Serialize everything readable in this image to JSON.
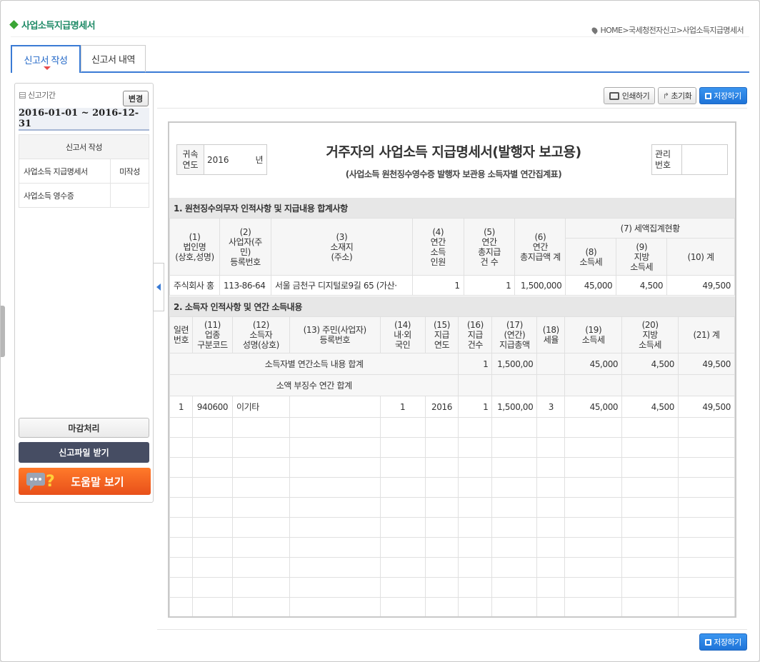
{
  "page": {
    "title": "사업소득지급명세서",
    "breadcrumb": [
      "HOME",
      ">",
      "국세청전자신고",
      ">",
      "사업소득지급명세서"
    ]
  },
  "tabs": [
    {
      "label": "신고서 작성",
      "active": true
    },
    {
      "label": "신고서 내역",
      "active": false
    }
  ],
  "sidebar": {
    "period_label": "신고기간",
    "change_button": "변경",
    "period_value": "2016-01-01 ~ 2016-12-31",
    "list_header": "신고서 작성",
    "items": [
      {
        "name": "사업소득 지급명세서",
        "status": "미작성"
      },
      {
        "name": "사업소득 영수증",
        "status": ""
      }
    ],
    "close_button": "마감처리",
    "file_button": "신고파일 받기",
    "help_button": "도움말 보기"
  },
  "toolbar": {
    "print": "인쇄하기",
    "reset": "초기화",
    "save": "저장하기"
  },
  "bottom": {
    "save": "저장하기"
  },
  "document": {
    "year_label": "귀속\n연도",
    "year_value": "2016",
    "year_unit": "년",
    "title": "거주자의 사업소득 지급명세서(발행자 보고용)",
    "subtitle": "(사업소득 원천징수영수증 발행자 보관용 소득자별 연간집계표)",
    "mgmt_label": "관리\n번호",
    "mgmt_value": "",
    "section1": {
      "title": "1. 원천징수의무자 인적사항 및 지급내용 합계사항",
      "headers": {
        "h1": "(1)\n법인명\n(상호,성명)",
        "h2": "(2)\n사업자(주\n민)\n등록번호",
        "h3": "(3)\n소재지\n(주소)",
        "h4": "(4)\n연간\n소득\n인원",
        "h5": "(5)\n연간\n총지급\n건 수",
        "h6": "(6)\n연간\n총지급액 계",
        "h7": "(7) 세액집계현황",
        "h8": "(8)\n소득세",
        "h9": "(9)\n지방\n소득세",
        "h10": "(10) 계"
      },
      "row": {
        "name": "주식회사 홍",
        "regno": "113-86-64",
        "addr": "서울 금천구 디지털로9길 65 (가산·",
        "count": "1",
        "cases": "1",
        "total": "1,500,000",
        "tax": "45,000",
        "local": "4,500",
        "sum": "49,500"
      }
    },
    "section2": {
      "title": "2. 소득자 인적사항 및 연간 소득내용",
      "headers": {
        "seq": "일련\n번호",
        "h11": "(11)\n업종\n구분코드",
        "h12": "(12)\n소득자\n성명(상호)",
        "h13": "(13) 주민(사업자)\n등록번호",
        "h14": "(14)\n내·외\n국인",
        "h15": "(15)\n지급\n연도",
        "h16": "(16)\n지급\n건수",
        "h17": "(17)\n(연간)\n지급총액",
        "h18": "(18)\n세율",
        "h19": "(19)\n소득세",
        "h20": "(20)\n지방\n소득세",
        "h21": "(21) 계"
      },
      "sum_row": {
        "label": "소득자별 연간소득 내용 합계",
        "cases": "1",
        "total": "1,500,00",
        "tax": "45,000",
        "local": "4,500",
        "sum": "49,500"
      },
      "small_row": {
        "label": "소액 부징수 연간 합계"
      },
      "rows": [
        {
          "seq": "1",
          "code": "940600",
          "name": "이기타",
          "regno": "",
          "foreign": "1",
          "year": "2016",
          "cases": "1",
          "total": "1,500,00",
          "rate": "3",
          "tax": "45,000",
          "local": "4,500",
          "sum": "49,500"
        }
      ]
    }
  }
}
